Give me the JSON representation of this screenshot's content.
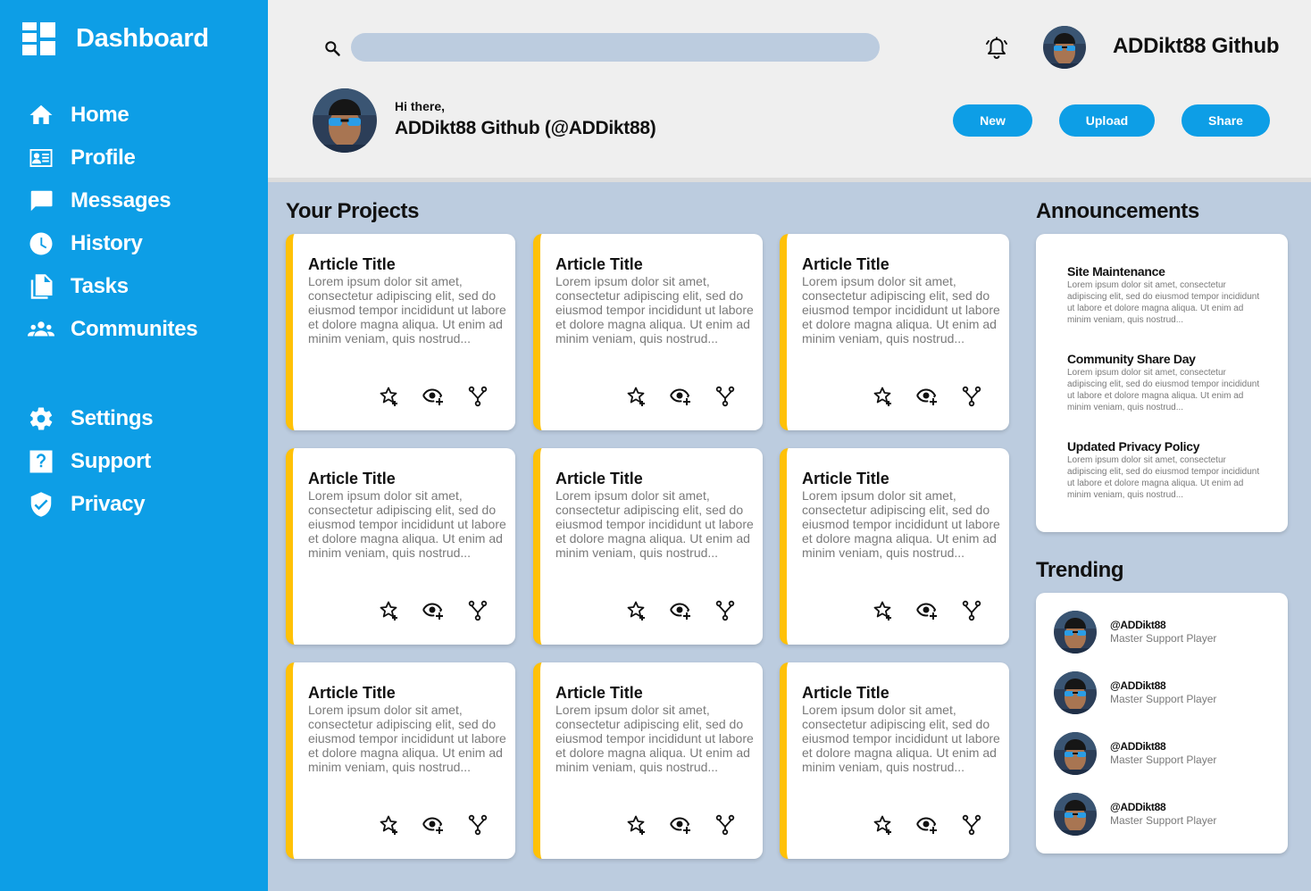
{
  "brand": {
    "title": "Dashboard",
    "icon": "dashboard-icon"
  },
  "sidebar": {
    "items": [
      {
        "label": "Home",
        "icon": "home-icon"
      },
      {
        "label": "Profile",
        "icon": "profile-card-icon"
      },
      {
        "label": "Messages",
        "icon": "message-icon"
      },
      {
        "label": "History",
        "icon": "clock-icon"
      },
      {
        "label": "Tasks",
        "icon": "documents-icon"
      },
      {
        "label": "Communites",
        "icon": "people-icon"
      }
    ],
    "secondary": [
      {
        "label": "Settings",
        "icon": "gear-icon"
      },
      {
        "label": "Support",
        "icon": "help-icon"
      },
      {
        "label": "Privacy",
        "icon": "shield-icon"
      }
    ]
  },
  "header": {
    "search": {
      "value": "",
      "placeholder": ""
    },
    "username": "ADDikt88 Github",
    "greeting_small": "Hi there,",
    "greeting_name": "ADDikt88 Github (@ADDikt88)",
    "buttons": {
      "new": "New",
      "upload": "Upload",
      "share": "Share"
    }
  },
  "projects": {
    "title": "Your Projects",
    "cards": [
      {
        "title": "Article Title",
        "body": "Lorem ipsum dolor sit amet, consectetur adipiscing elit, sed do eiusmod tempor incididunt ut labore et dolore magna aliqua. Ut enim ad minim veniam, quis nostrud..."
      },
      {
        "title": "Article Title",
        "body": "Lorem ipsum dolor sit amet, consectetur adipiscing elit, sed do eiusmod tempor incididunt ut labore et dolore magna aliqua. Ut enim ad minim veniam, quis nostrud..."
      },
      {
        "title": "Article Title",
        "body": "Lorem ipsum dolor sit amet, consectetur adipiscing elit, sed do eiusmod tempor incididunt ut labore et dolore magna aliqua. Ut enim ad minim veniam, quis nostrud..."
      },
      {
        "title": "Article Title",
        "body": "Lorem ipsum dolor sit amet, consectetur adipiscing elit, sed do eiusmod tempor incididunt ut labore et dolore magna aliqua. Ut enim ad minim veniam, quis nostrud..."
      },
      {
        "title": "Article Title",
        "body": "Lorem ipsum dolor sit amet, consectetur adipiscing elit, sed do eiusmod tempor incididunt ut labore et dolore magna aliqua. Ut enim ad minim veniam, quis nostrud..."
      },
      {
        "title": "Article Title",
        "body": "Lorem ipsum dolor sit amet, consectetur adipiscing elit, sed do eiusmod tempor incididunt ut labore et dolore magna aliqua. Ut enim ad minim veniam, quis nostrud..."
      },
      {
        "title": "Article Title",
        "body": "Lorem ipsum dolor sit amet, consectetur adipiscing elit, sed do eiusmod tempor incididunt ut labore et dolore magna aliqua. Ut enim ad minim veniam, quis nostrud..."
      },
      {
        "title": "Article Title",
        "body": "Lorem ipsum dolor sit amet, consectetur adipiscing elit, sed do eiusmod tempor incididunt ut labore et dolore magna aliqua. Ut enim ad minim veniam, quis nostrud..."
      },
      {
        "title": "Article Title",
        "body": "Lorem ipsum dolor sit amet, consectetur adipiscing elit, sed do eiusmod tempor incididunt ut labore et dolore magna aliqua. Ut enim ad minim veniam, quis nostrud..."
      }
    ]
  },
  "announcements": {
    "title": "Announcements",
    "items": [
      {
        "title": "Site Maintenance",
        "body": "Lorem ipsum dolor sit amet, consectetur adipiscing elit, sed do eiusmod tempor incididunt ut labore et dolore magna aliqua. Ut enim ad minim veniam, quis nostrud..."
      },
      {
        "title": "Community Share Day",
        "body": "Lorem ipsum dolor sit amet, consectetur adipiscing elit, sed do eiusmod tempor incididunt ut labore et dolore magna aliqua. Ut enim ad minim veniam, quis nostrud..."
      },
      {
        "title": "Updated Privacy Policy",
        "body": "Lorem ipsum dolor sit amet, consectetur adipiscing elit, sed do eiusmod tempor incididunt ut labore et dolore magna aliqua. Ut enim ad minim veniam, quis nostrud..."
      }
    ]
  },
  "trending": {
    "title": "Trending",
    "items": [
      {
        "handle": "@ADDikt88",
        "role": "Master Support Player"
      },
      {
        "handle": "@ADDikt88",
        "role": "Master Support Player"
      },
      {
        "handle": "@ADDikt88",
        "role": "Master Support Player"
      },
      {
        "handle": "@ADDikt88",
        "role": "Master Support Player"
      }
    ]
  },
  "colors": {
    "accent": "#0d9ee6",
    "card_stripe": "#ffc107",
    "background": "#bcccdf",
    "header": "#efefef"
  }
}
